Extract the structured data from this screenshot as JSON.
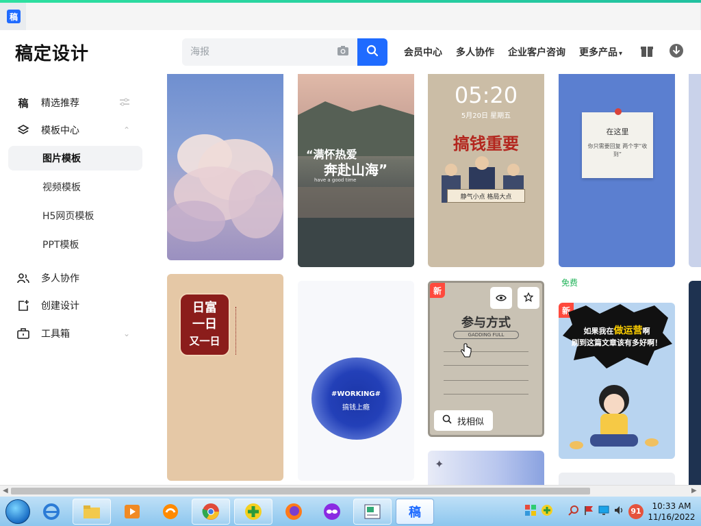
{
  "browser": {
    "favicon_text": "稿"
  },
  "header": {
    "brand": "稿定设计",
    "search_placeholder": "海报",
    "nav": [
      "会员中心",
      "多人协作",
      "企业客户咨询",
      "更多产品"
    ]
  },
  "sidebar": {
    "items": [
      {
        "label": "精选推荐",
        "icon": "logo-icon"
      },
      {
        "label": "模板中心",
        "icon": "layers-icon"
      },
      {
        "label": "多人协作",
        "icon": "users-icon"
      },
      {
        "label": "创建设计",
        "icon": "add-design-icon"
      },
      {
        "label": "工具箱",
        "icon": "toolbox-icon"
      }
    ],
    "sub_items": [
      "图片模板",
      "视频模板",
      "H5网页模板",
      "PPT模板"
    ]
  },
  "cards": {
    "card2_quote_top": "“满怀热爱",
    "card2_quote_bottom": "奔赴山海”",
    "card2_small": "have a good time",
    "card3_time": "05:20",
    "card3_date": "5月20日 星期五",
    "card3_title": "搞钱重要",
    "card3_sub": "静气小点  格局大点",
    "card4_note_title": "在这里",
    "card4_note_body": "你只需要回复 两个字“收到”",
    "card5_line1": "日富",
    "card5_line2": "一日",
    "card5_line3": "又一日",
    "card6_line1": "#WORKING#",
    "card6_line2": "搞钱上瘾",
    "card7_badge": "新",
    "card7_title": "参与方式",
    "card7_sub": "GADDING FULL",
    "card7_find_similar": "找相似",
    "free_label": "免费",
    "card8_badge": "新",
    "card8_line1": "如果我在",
    "card8_highlight": "做运营",
    "card8_line1_end": "啊",
    "card8_line2": "刷到这篇文章该有多好啊！"
  },
  "taskbar": {
    "time": "10:33 AM",
    "date": "11/16/2022",
    "notif": "91",
    "active_app_label": "稿"
  }
}
